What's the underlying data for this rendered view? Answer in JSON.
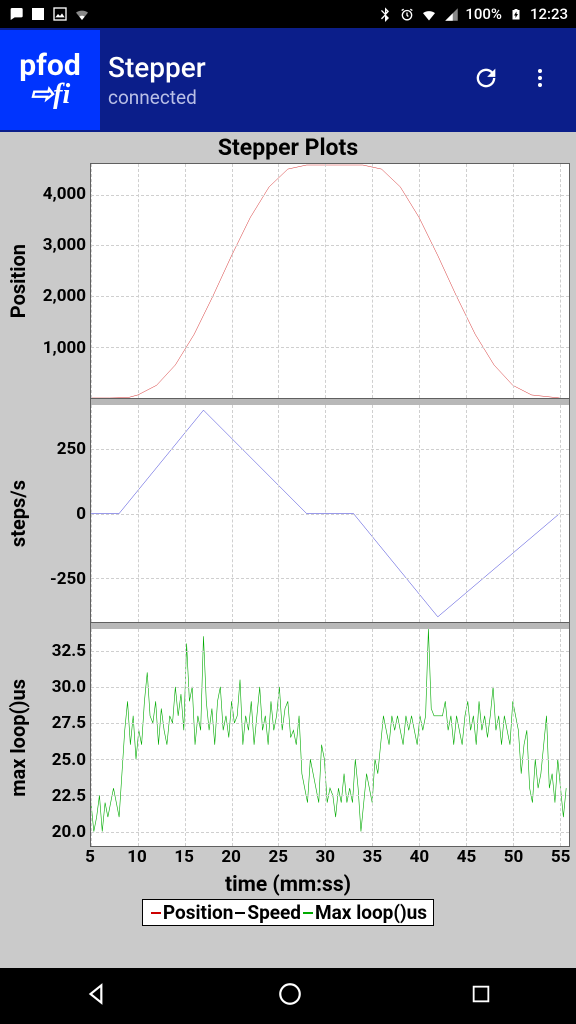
{
  "status": {
    "battery": "100%",
    "time": "12:23"
  },
  "appbar": {
    "logo_l1": "pfod",
    "logo_l2": "⇨fi",
    "title": "Stepper",
    "subtitle": "connected"
  },
  "plots": {
    "title": "Stepper Plots",
    "xlabel": "time (mm:ss)",
    "xticks": [
      5,
      10,
      15,
      20,
      25,
      30,
      35,
      40,
      45,
      50,
      55
    ],
    "legend": {
      "a": "Position",
      "b": "Speed",
      "c": "Max loop()us"
    }
  },
  "chart_data": [
    {
      "type": "line",
      "title": "Stepper Plots",
      "xlabel": "time (mm:ss)",
      "ylabel": "Position",
      "ylim": [
        0,
        4600
      ],
      "yticks": [
        1000,
        2000,
        3000,
        4000
      ],
      "color": "#cc0000",
      "x": [
        5,
        7,
        9,
        10,
        12,
        14,
        16,
        18,
        20,
        22,
        24,
        26,
        28,
        30,
        32,
        34,
        36,
        38,
        40,
        42,
        44,
        46,
        48,
        50,
        52,
        55
      ],
      "y": [
        0,
        0,
        10,
        60,
        250,
        650,
        1250,
        2000,
        2800,
        3550,
        4150,
        4500,
        4580,
        4580,
        4580,
        4580,
        4500,
        4150,
        3550,
        2800,
        2000,
        1250,
        650,
        250,
        60,
        0
      ]
    },
    {
      "type": "line",
      "xlabel": "time (mm:ss)",
      "ylabel": "steps/s",
      "ylim": [
        -420,
        420
      ],
      "yticks": [
        -250,
        0,
        250
      ],
      "color": "#0000cc",
      "x": [
        5,
        8,
        17,
        28,
        33,
        42,
        55
      ],
      "y": [
        0,
        0,
        400,
        0,
        0,
        -400,
        0
      ]
    },
    {
      "type": "line",
      "xlabel": "time (mm:ss)",
      "ylabel": "max loop()us",
      "ylim": [
        19,
        34
      ],
      "yticks": [
        20.0,
        22.5,
        25.0,
        27.5,
        30.0,
        32.5
      ],
      "color": "#00aa00",
      "x": [
        5,
        5.3,
        5.6,
        5.9,
        6.2,
        6.5,
        6.8,
        7.1,
        7.4,
        7.7,
        8,
        8.3,
        8.6,
        8.9,
        9.2,
        9.5,
        9.8,
        10.1,
        10.4,
        10.7,
        11,
        11.3,
        11.6,
        11.9,
        12.2,
        12.5,
        12.8,
        13.1,
        13.4,
        13.7,
        14,
        14.3,
        14.6,
        14.9,
        15.2,
        15.5,
        15.8,
        16.1,
        16.4,
        16.7,
        17,
        17.3,
        17.6,
        17.9,
        18.2,
        18.5,
        18.8,
        19.1,
        19.4,
        19.7,
        20,
        20.3,
        20.6,
        20.9,
        21.2,
        21.5,
        21.8,
        22.1,
        22.4,
        22.7,
        23,
        23.3,
        23.6,
        23.9,
        24.2,
        24.5,
        24.8,
        25.1,
        25.4,
        25.7,
        26,
        26.3,
        26.6,
        26.9,
        27.2,
        27.5,
        27.8,
        28.1,
        28.4,
        28.7,
        29,
        29.3,
        29.6,
        29.9,
        30.2,
        30.5,
        30.8,
        31.1,
        31.4,
        31.7,
        32,
        32.3,
        32.6,
        32.9,
        33.2,
        33.5,
        33.8,
        34.1,
        34.4,
        34.7,
        35,
        35.3,
        35.6,
        35.9,
        36.2,
        36.5,
        36.8,
        37.1,
        37.4,
        37.7,
        38,
        38.3,
        38.6,
        38.9,
        39.2,
        39.5,
        39.8,
        40.1,
        40.4,
        40.7,
        41,
        41.3,
        41.6,
        41.9,
        42.2,
        42.5,
        42.8,
        43.1,
        43.4,
        43.7,
        44,
        44.3,
        44.6,
        44.9,
        45.2,
        45.5,
        45.8,
        46.1,
        46.4,
        46.7,
        47,
        47.3,
        47.6,
        47.9,
        48.2,
        48.5,
        48.8,
        49.1,
        49.4,
        49.7,
        50,
        50.3,
        50.6,
        50.9,
        51.2,
        51.5,
        51.8,
        52.1,
        52.4,
        52.7,
        53,
        53.3,
        53.6,
        53.9,
        54.2,
        54.5,
        54.8,
        55.1,
        55.4,
        55.7
      ],
      "y": [
        22,
        20,
        21,
        22.5,
        20,
        22,
        21,
        22,
        23,
        22,
        21,
        24,
        27,
        29,
        26,
        28,
        25,
        27,
        26,
        29,
        31,
        28,
        27.5,
        29,
        26,
        28.5,
        27,
        26,
        28,
        27.5,
        30,
        28,
        29.5,
        27,
        33,
        29,
        30,
        26,
        28,
        27,
        33.5,
        29,
        27,
        28.5,
        26,
        29,
        30,
        27,
        28,
        26.5,
        29,
        27.5,
        28,
        30.5,
        26,
        28,
        27,
        29,
        26,
        28,
        30,
        27,
        28,
        26,
        29,
        27,
        28,
        30,
        27,
        28.5,
        29,
        26.5,
        27,
        26,
        28,
        24,
        23,
        22,
        25,
        24,
        23,
        22,
        26,
        25,
        22,
        23,
        22.5,
        21,
        23,
        22,
        24,
        22,
        23,
        22,
        25,
        23,
        20,
        22,
        24,
        23,
        22,
        25,
        24,
        26,
        28,
        27,
        26,
        28,
        27,
        28,
        27,
        26,
        28,
        27,
        28,
        27,
        26,
        28,
        27,
        28,
        34,
        28.5,
        28,
        28,
        28,
        28,
        29,
        27,
        28,
        26,
        28,
        27,
        26,
        28,
        29,
        27,
        28,
        26,
        29,
        27,
        28,
        26.5,
        28,
        30,
        27,
        28,
        26,
        28,
        27,
        26,
        29,
        28,
        27,
        24,
        26,
        27,
        23,
        22,
        25,
        23,
        24,
        26,
        28,
        23,
        24,
        22,
        25,
        23,
        21,
        23
      ]
    }
  ]
}
